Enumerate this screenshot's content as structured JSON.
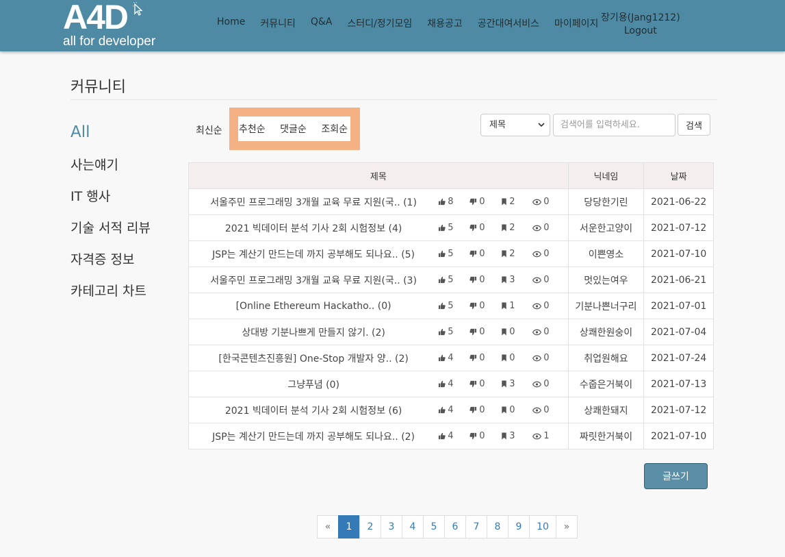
{
  "header": {
    "logo_main": "A4D",
    "logo_sub": "all for developer",
    "nav": [
      "Home",
      "커뮤니티",
      "Q&A",
      "스터디/정기모임",
      "채용공고",
      "공간대여서비스",
      "마이페이지"
    ],
    "user_name": "장기용(Jang1212)",
    "logout_label": "Logout",
    "brand_color": "#4e8aa3"
  },
  "page_title": "커뮤니티",
  "sidebar": {
    "items": [
      {
        "label": "All",
        "active": true
      },
      {
        "label": "사는얘기"
      },
      {
        "label": "IT 행사"
      },
      {
        "label": "기술 서적 리뷰"
      },
      {
        "label": "자격증 정보"
      },
      {
        "label": "카테고리 차트"
      }
    ]
  },
  "sort": {
    "latest": "최신순",
    "options": [
      "추천순",
      "댓글순",
      "조회순"
    ],
    "highlight_color": "#f4b183"
  },
  "search": {
    "select_value": "제목",
    "placeholder": "검색어를 입력하세요.",
    "button_label": "검색"
  },
  "table": {
    "headers": {
      "title": "제목",
      "nick": "닉네임",
      "date": "날짜"
    },
    "rows": [
      {
        "title": "서울주민 프로그래밍 3개월 교육 무료 지원(국.. (1)",
        "likes": "8",
        "dislikes": "0",
        "bookmarks": "2",
        "views": "0",
        "nick": "당당한기린",
        "date": "2021-06-22"
      },
      {
        "title": "2021 빅데이터 분석 기사 2회 시험정보 (4)",
        "likes": "5",
        "dislikes": "0",
        "bookmarks": "2",
        "views": "0",
        "nick": "서운한고양이",
        "date": "2021-07-12"
      },
      {
        "title": "JSP는 계산기 만드는데 까지 공부해도 되나요.. (5)",
        "likes": "5",
        "dislikes": "0",
        "bookmarks": "2",
        "views": "0",
        "nick": "이쁜영소",
        "date": "2021-07-10"
      },
      {
        "title": "서울주민 프로그래밍 3개월 교육 무료 지원(국.. (3)",
        "likes": "5",
        "dislikes": "0",
        "bookmarks": "3",
        "views": "0",
        "nick": "멋있는여우",
        "date": "2021-06-21"
      },
      {
        "title": "[Online Ethereum Hackatho.. (0)",
        "likes": "5",
        "dislikes": "0",
        "bookmarks": "1",
        "views": "0",
        "nick": "기분나쁜너구리",
        "date": "2021-07-01"
      },
      {
        "title": "상대방 기분나쁘게 만들지 않기. (2)",
        "likes": "5",
        "dislikes": "0",
        "bookmarks": "0",
        "views": "0",
        "nick": "상쾌한원숭이",
        "date": "2021-07-04"
      },
      {
        "title": "[한국콘텐츠진흥원] One-Stop 개발자 양.. (2)",
        "likes": "4",
        "dislikes": "0",
        "bookmarks": "0",
        "views": "0",
        "nick": "취업원해요",
        "date": "2021-07-24"
      },
      {
        "title": "그냥푸념 (0)",
        "likes": "4",
        "dislikes": "0",
        "bookmarks": "3",
        "views": "0",
        "nick": "수줍은거북이",
        "date": "2021-07-13"
      },
      {
        "title": "2021 빅데이터 분석 기사 2회 시험정보 (6)",
        "likes": "4",
        "dislikes": "0",
        "bookmarks": "0",
        "views": "0",
        "nick": "상쾌한돼지",
        "date": "2021-07-12"
      },
      {
        "title": "JSP는 계산기 만드는데 까지 공부해도 되나요.. (2)",
        "likes": "4",
        "dislikes": "0",
        "bookmarks": "3",
        "views": "1",
        "nick": "짜릿한거북이",
        "date": "2021-07-10"
      }
    ]
  },
  "write_button": "글쓰기",
  "pagination": {
    "prev": "«",
    "pages": [
      "1",
      "2",
      "3",
      "4",
      "5",
      "6",
      "7",
      "8",
      "9",
      "10"
    ],
    "active": "1",
    "next": "»"
  }
}
